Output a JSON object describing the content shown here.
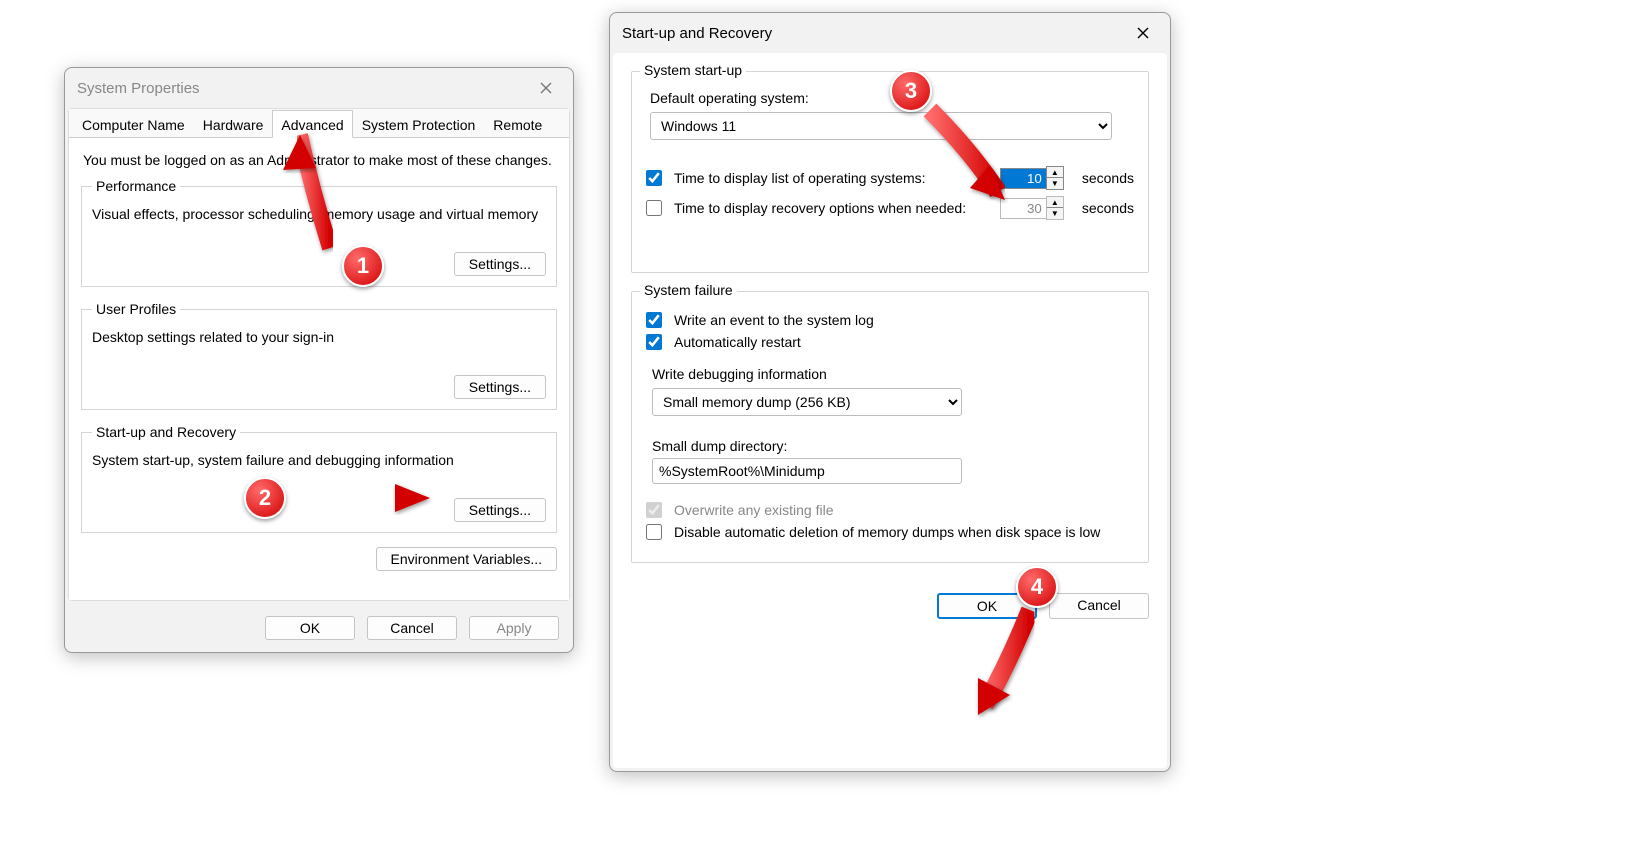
{
  "dialog1": {
    "title": "System Properties",
    "tabs": [
      "Computer Name",
      "Hardware",
      "Advanced",
      "System Protection",
      "Remote"
    ],
    "active_tab": 2,
    "note": "You must be logged on as an Administrator to make most of these changes.",
    "sections": {
      "performance": {
        "legend": "Performance",
        "desc": "Visual effects, processor scheduling, memory usage and virtual memory",
        "button": "Settings..."
      },
      "profiles": {
        "legend": "User Profiles",
        "desc": "Desktop settings related to your sign-in",
        "button": "Settings..."
      },
      "startup": {
        "legend": "Start-up and Recovery",
        "desc": "System start-up, system failure and debugging information",
        "button": "Settings..."
      }
    },
    "env_button": "Environment Variables...",
    "buttons": {
      "ok": "OK",
      "cancel": "Cancel",
      "apply": "Apply"
    }
  },
  "dialog2": {
    "title": "Start-up and Recovery",
    "group1": {
      "title": "System start-up",
      "default_label": "Default operating system:",
      "default_value": "Windows 11",
      "row1_label": "Time to display list of operating systems:",
      "row1_value": "10",
      "row2_label": "Time to display recovery options when needed:",
      "row2_value": "30",
      "seconds": "seconds"
    },
    "group2": {
      "title": "System failure",
      "chk1": "Write an event to the system log",
      "chk2": "Automatically restart",
      "write_label": "Write debugging information",
      "write_value": "Small memory dump (256 KB)",
      "dir_label": "Small dump directory:",
      "dir_value": "%SystemRoot%\\Minidump",
      "chk3": "Overwrite any existing file",
      "chk4": "Disable automatic deletion of memory dumps when disk space is low"
    },
    "buttons": {
      "ok": "OK",
      "cancel": "Cancel"
    }
  },
  "markers": [
    "1",
    "2",
    "3",
    "4"
  ]
}
